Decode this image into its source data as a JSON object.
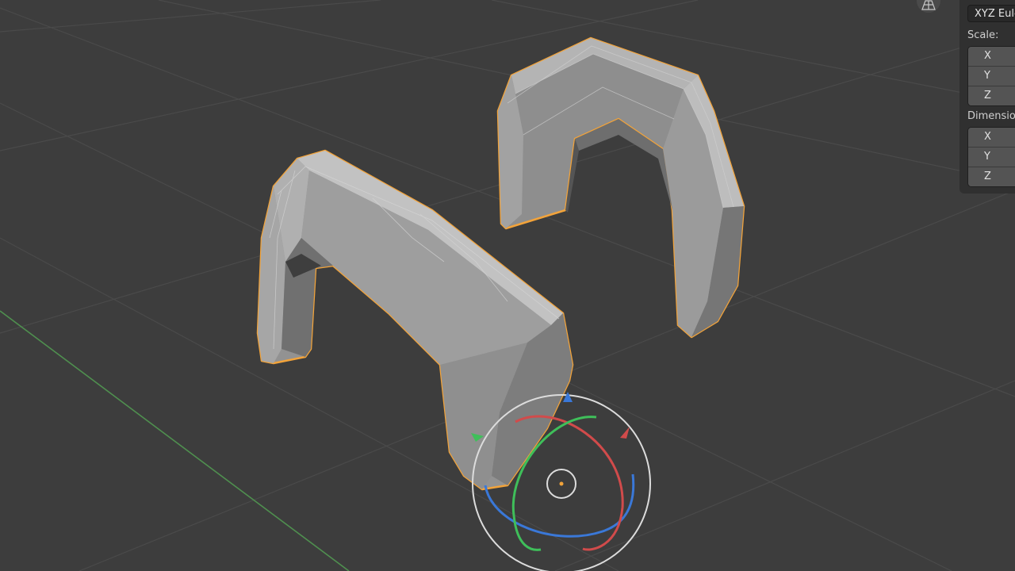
{
  "n_panel": {
    "rotation_mode": "XYZ Euler",
    "scale_label": "Scale:",
    "scale_axes": [
      "X",
      "Y",
      "Z"
    ],
    "dimensions_label": "Dimensions:",
    "dimension_axes": [
      "X",
      "Y",
      "Z"
    ]
  },
  "icons": {
    "view_toggle": "perspective-grid-icon",
    "gizmo": "rotate-gizmo-icon"
  },
  "colors": {
    "background": "#3d3d3d",
    "selection_outline": "#f2a33a",
    "gizmo_x": "#d14b4b",
    "gizmo_y": "#3fbf5a",
    "gizmo_z": "#3a78d8",
    "gizmo_trackball": "#dcdcdc"
  }
}
